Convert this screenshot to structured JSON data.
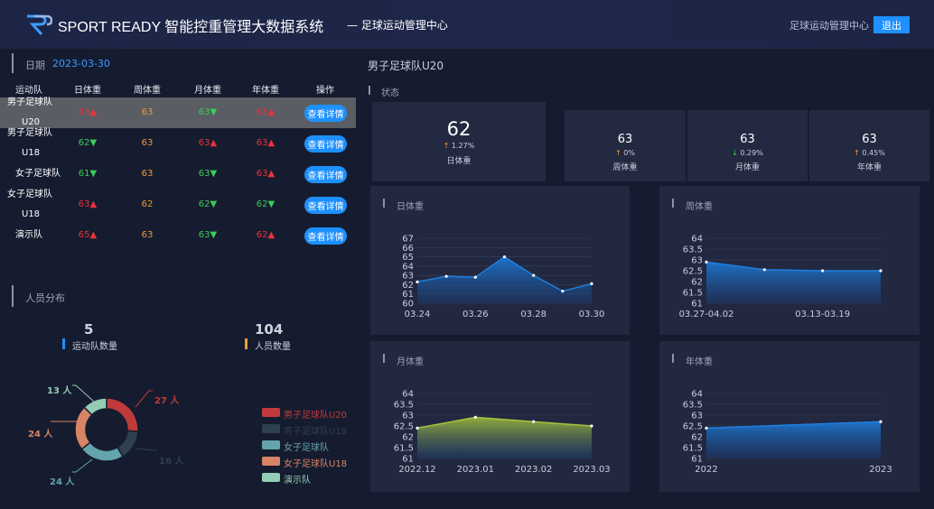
{
  "header": {
    "title": "SPORT READY 智能控重管理大数据系统",
    "subtitle": "— 足球运动管理中心",
    "user": "足球运动管理中心",
    "logout": "退出"
  },
  "date": {
    "label": "日期",
    "value": "2023-03-30"
  },
  "table": {
    "headers": [
      "运动队",
      "日体重",
      "周体重",
      "月体重",
      "年体重",
      "操作"
    ],
    "rows": [
      {
        "team1": "男子足球队",
        "team2": "U20",
        "day": "63▲",
        "day_c": "up",
        "week": "63",
        "week_c": "same",
        "month": "63▼",
        "month_c": "down",
        "year": "63▲",
        "year_c": "up",
        "action": "查看详情"
      },
      {
        "team1": "男子足球队",
        "team2": "U18",
        "day": "62▼",
        "day_c": "down",
        "week": "63",
        "week_c": "same",
        "month": "63▲",
        "month_c": "up",
        "year": "63▲",
        "year_c": "up",
        "action": "查看详情"
      },
      {
        "team1": "女子足球队",
        "team2": "",
        "day": "61▼",
        "day_c": "down",
        "week": "63",
        "week_c": "same",
        "month": "63▼",
        "month_c": "down",
        "year": "63▲",
        "year_c": "up",
        "action": "查看详情"
      },
      {
        "team1": "女子足球队",
        "team2": "U18",
        "day": "63▲",
        "day_c": "up",
        "week": "62",
        "week_c": "same",
        "month": "62▼",
        "month_c": "down",
        "year": "62▼",
        "year_c": "down",
        "action": "查看详情"
      },
      {
        "team1": "演示队",
        "team2": "",
        "day": "65▲",
        "day_c": "up",
        "week": "63",
        "week_c": "same",
        "month": "63▼",
        "month_c": "down",
        "year": "62▲",
        "year_c": "up",
        "action": "查看详情"
      }
    ]
  },
  "people": {
    "title": "人员分布",
    "teams_count": "5",
    "teams_label": "运动队数量",
    "people_count": "104",
    "people_label": "人员数量"
  },
  "donut_chart": {
    "type": "pie",
    "unit": "人",
    "slices": [
      {
        "name": "男子足球队U20",
        "value": 27,
        "label": "27 人",
        "color": "#c0393b"
      },
      {
        "name": "男子足球队U18",
        "value": 16,
        "label": "16 人",
        "color": "#2f4050"
      },
      {
        "name": "女子足球队",
        "value": 24,
        "label": "24 人",
        "color": "#64a4ad"
      },
      {
        "name": "女子足球队U18",
        "value": 24,
        "label": "24 人",
        "color": "#d88467"
      },
      {
        "name": "演示队",
        "value": 13,
        "label": "13 人",
        "color": "#93cdb4"
      }
    ]
  },
  "right": {
    "team_title": "男子足球队U20",
    "status_label": "状态",
    "cards": [
      {
        "value": "62",
        "pct": "↑ 1.27%",
        "arrow_color": "#f19a34",
        "label": "日体重"
      },
      {
        "value": "63",
        "pct": "↑ 0%",
        "arrow_color": "#f19a34",
        "label": "周体重"
      },
      {
        "value": "63",
        "pct": "↓ 0.29%",
        "arrow_color": "#3ccb5a",
        "label": "月体重"
      },
      {
        "value": "63",
        "pct": "↑ 0.45%",
        "arrow_color": "#f19a34",
        "label": "年体重"
      }
    ]
  },
  "chart_data": [
    {
      "type": "area",
      "title": "日体重",
      "x": [
        "03.24",
        "03.25",
        "03.26",
        "03.27",
        "03.28",
        "03.29",
        "03.30"
      ],
      "x_ticks": [
        "03.24",
        "03.26",
        "03.28",
        "03.30"
      ],
      "values": [
        62.3,
        62.9,
        62.8,
        65.0,
        63.0,
        61.3,
        62.1
      ],
      "ylim": [
        60,
        67
      ],
      "yticks": [
        60,
        61,
        62,
        63,
        64,
        65,
        66,
        67
      ],
      "color": "#1e7fe0"
    },
    {
      "type": "area",
      "title": "周体重",
      "x": [
        "03.27-04.02",
        "",
        "03.13-03.19",
        ""
      ],
      "x_ticks": [
        "03.27-04.02",
        "03.13-03.19"
      ],
      "values": [
        62.9,
        62.55,
        62.5,
        62.5
      ],
      "ylim": [
        61,
        64
      ],
      "yticks": [
        61,
        61.5,
        62,
        62.5,
        63,
        63.5,
        64
      ],
      "color": "#1e7fe0"
    },
    {
      "type": "area",
      "title": "月体重",
      "x": [
        "2022.12",
        "2023.01",
        "2023.02",
        "2023.03"
      ],
      "x_ticks": [
        "2022.12",
        "2023.01",
        "2023.02",
        "2023.03"
      ],
      "values": [
        62.4,
        62.9,
        62.7,
        62.5
      ],
      "ylim": [
        61,
        64
      ],
      "yticks": [
        61,
        61.5,
        62,
        62.5,
        63,
        63.5,
        64
      ],
      "color": "#a5c43a"
    },
    {
      "type": "area",
      "title": "年体重",
      "x": [
        "2022",
        "2023"
      ],
      "x_ticks": [
        "2022",
        "2023"
      ],
      "values": [
        62.4,
        62.7
      ],
      "ylim": [
        61,
        64
      ],
      "yticks": [
        61,
        61.5,
        62,
        62.5,
        63,
        63.5,
        64
      ],
      "color": "#1e7fe0"
    }
  ]
}
